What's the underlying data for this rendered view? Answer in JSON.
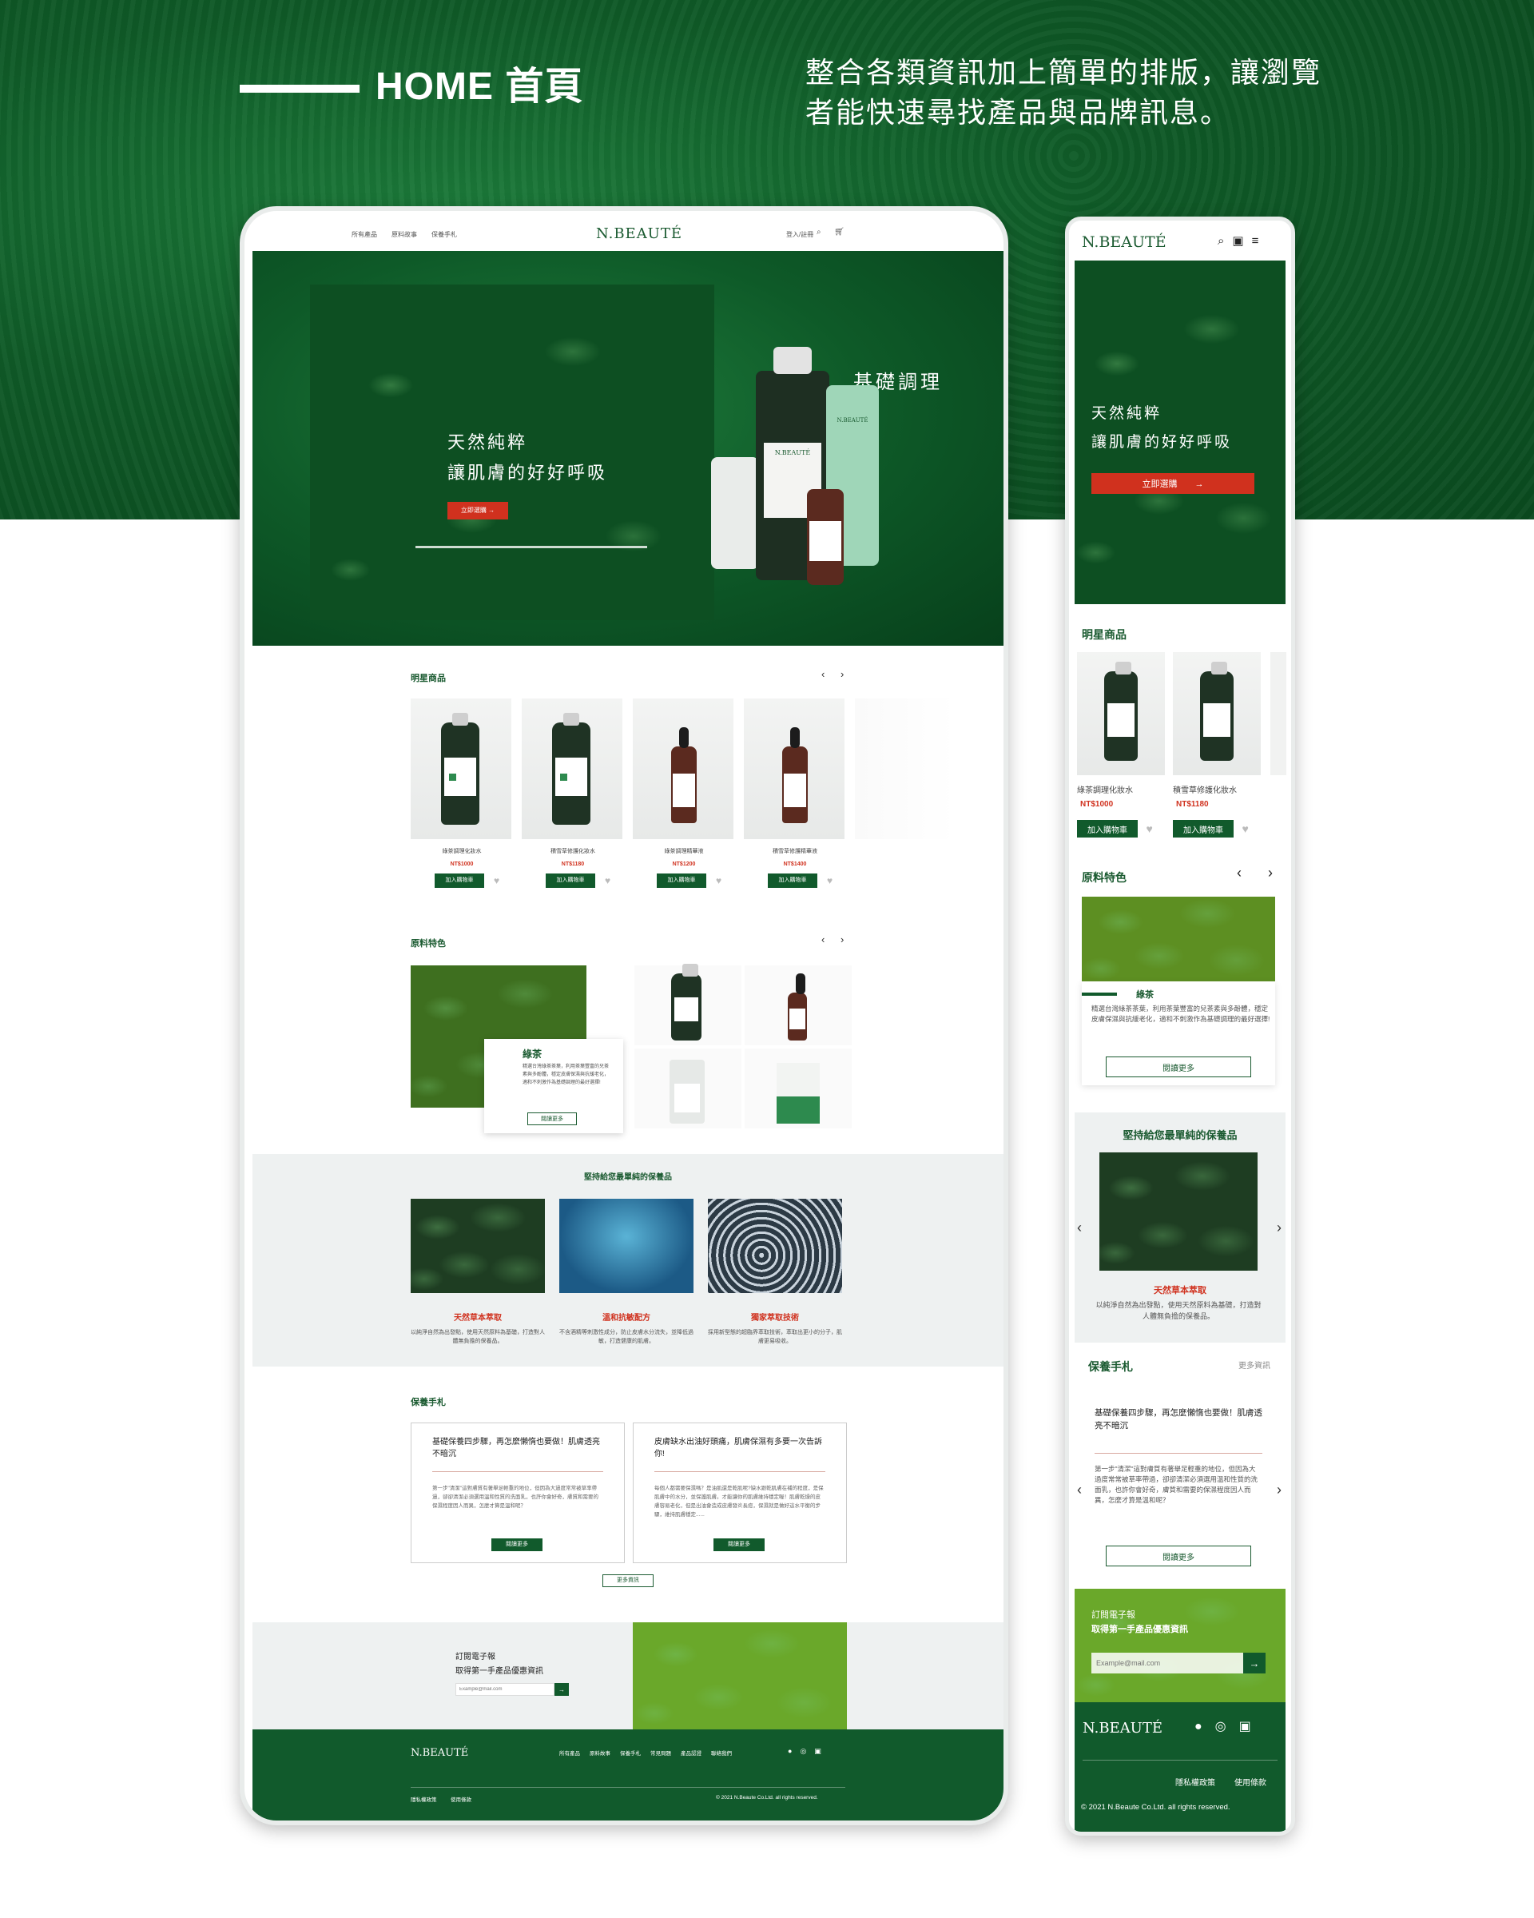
{
  "header": {
    "title": "HOME 首頁",
    "description": "整合各類資訊加上簡單的排版，讓瀏覽者能快速尋找產品與品牌訊息。"
  },
  "desktop": {
    "nav": {
      "links": [
        "所有產品",
        "原料故事",
        "保養手札"
      ],
      "logo": "N.BEAUTÉ",
      "login": "登入/註冊"
    },
    "hero": {
      "line1": "天然純粹",
      "line2": "讓肌膚的好好呼吸",
      "button": "立即選購",
      "script": "基礎調理",
      "bottle_labels": [
        "N.BEAUTÉ",
        "N.BEAUTÉ",
        "N.BEAUTÉ"
      ]
    },
    "featured": {
      "title": "明星商品",
      "products": [
        {
          "name": "綠茶調理化妝水",
          "price": "NT$1000",
          "button": "加入購物車"
        },
        {
          "name": "積雪草修護化妝水",
          "price": "NT$1180",
          "button": "加入購物車"
        },
        {
          "name": "綠茶調理精華液",
          "price": "NT$1200",
          "button": "加入購物車"
        },
        {
          "name": "積雪草修護精華液",
          "price": "NT$1400",
          "button": "加入購物車"
        }
      ]
    },
    "ingredients": {
      "title": "原料特色",
      "card_title": "綠茶",
      "card_text": "精選台灣綠茶茶葉，利用茶葉豐富的兒茶素與多酚體，穩定皮膚保濕與抗緩老化，適和不刺激作為基礎調理的最好選擇!",
      "card_button": "閱讀更多"
    },
    "values": {
      "title": "堅持給您最單純的保養品",
      "items": [
        {
          "title": "天然草本萃取",
          "desc": "以純淨自然為出發點，使用天然原料為基礎，打造對人體無負擔的保養品。"
        },
        {
          "title": "溫和抗敏配方",
          "desc": "不含酒精等刺激性成分，防止皮膚水分流失，並降低過敏，打造健康的肌膚。"
        },
        {
          "title": "獨家萃取技術",
          "desc": "採用新型態的超臨界萃取技術，萃取出更小的分子，肌膚更易吸收。"
        }
      ]
    },
    "journal": {
      "title": "保養手札",
      "posts": [
        {
          "title": "基礎保養四步驟，再怎麼懶惰也要做！肌膚透亮不暗沉",
          "text": "第一步\"清潔\"這對膚質有著舉足輕重的地位，但因為大過度常常被草率帶過，卻卻清潔必須選用溫和性質的洗面乳，也許你會好奇，膚質和需要的保濕程度因人而異，怎麼才算是溫和呢？",
          "button": "閱讀更多"
        },
        {
          "title": "皮膚缺水出油好頭痛，肌膚保濕有多要一次告訴你!",
          "text": "每個人都需要保濕嗎？是油肌還是乾肌呢?缺水跟乾肌膚在補的程度，是保肌膚中的水分，並保護肌膚。才能讓你的肌膚維持穩定喔！肌膚乾燥的皮膚容易老化，但是出油會造成皮膚發炎長痘，保濕就是做好這水平衡的步驟，維持肌膚穩定......",
          "button": "閱讀更多"
        }
      ],
      "more": "更多資訊"
    },
    "newsletter": {
      "line1": "訂閱電子報",
      "line2": "取得第一手產品優惠資訊",
      "placeholder": "Example@mail.com"
    },
    "footer": {
      "logo": "N.BEAUTÉ",
      "links": [
        "所有產品",
        "原料故事",
        "保養手札",
        "常見問題",
        "產品認證",
        "聯絡我們"
      ],
      "legal": [
        "隱私權政策",
        "使用條款"
      ],
      "copyright": "© 2021 N.Beaute Co.Ltd. all rights reserved."
    }
  },
  "mobile": {
    "logo": "N.BEAUTÉ",
    "hero": {
      "line1": "天然純粹",
      "line2": "讓肌膚的好好呼吸",
      "button": "立即選購"
    },
    "featured": {
      "title": "明星商品",
      "products": [
        {
          "name": "綠茶調理化妝水",
          "price": "NT$1000",
          "button": "加入購物車"
        },
        {
          "name": "積雪草修護化妝水",
          "price": "NT$1180",
          "button": "加入購物車"
        }
      ]
    },
    "ingredients": {
      "title": "原料特色",
      "card_title": "綠茶",
      "card_text": "精選台灣綠茶茶葉，利用茶葉豐富的兒茶素與多酚體，穩定皮膚保濕與抗緩老化，適和不刺激作為基礎調理的最好選擇!",
      "card_button": "閱讀更多"
    },
    "values": {
      "title": "堅持給您最單純的保養品",
      "item_title": "天然草本萃取",
      "item_desc": "以純淨自然為出發點，使用天然原料為基礎，打造對人體無負擔的保養品。"
    },
    "journal": {
      "title": "保養手札",
      "more": "更多資訊",
      "post_title": "基礎保養四步驟，再怎麼懶惰也要做！肌膚透亮不暗沉",
      "post_text": "第一步\"清潔\"這對膚質有著舉足輕重的地位，但因為大過度常常被草率帶過，卻卻清潔必須選用溫和性質的洗面乳，也許你會好奇，膚質和需要的保濕程度因人而異，怎麼才算是溫和呢？",
      "button": "閱讀更多"
    },
    "newsletter": {
      "line1": "訂閱電子報",
      "line2": "取得第一手產品優惠資訊",
      "placeholder": "Example@mail.com"
    },
    "footer": {
      "logo": "N.BEAUTÉ",
      "legal": [
        "隱私權政策",
        "使用條款"
      ],
      "copyright": "© 2021 N.Beaute Co.Ltd. all rights reserved."
    }
  },
  "colors": {
    "brand_green": "#115a2c",
    "accent_red": "#d0311e",
    "light_gray": "#eef1f1"
  }
}
